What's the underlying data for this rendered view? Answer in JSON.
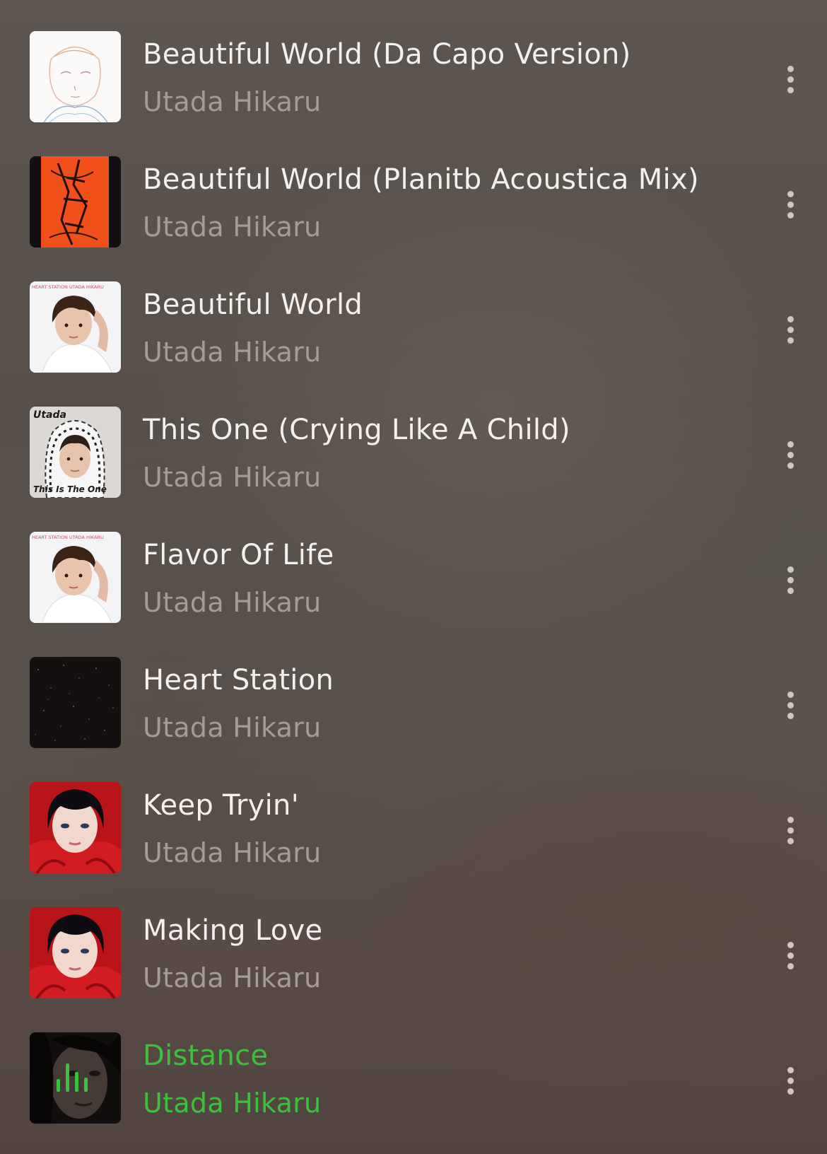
{
  "tracks": [
    {
      "title": "Beautiful World (Da Capo Version)",
      "artist": "Utada Hikaru",
      "cover": "sketch-portrait"
    },
    {
      "title": "Beautiful World (Planitb Acoustica Mix)",
      "artist": "Utada Hikaru",
      "cover": "orange-sketch"
    },
    {
      "title": "Beautiful World",
      "artist": "Utada Hikaru",
      "cover": "heart-station",
      "cover_text": "HEART STATION  UTADA HIKARU"
    },
    {
      "title": "This One (Crying Like A Child)",
      "artist": "Utada Hikaru",
      "cover": "this-is-the-one",
      "cover_text_top": "Utada",
      "cover_text_bottom": "This Is The One"
    },
    {
      "title": "Flavor Of Life",
      "artist": "Utada Hikaru",
      "cover": "heart-station",
      "cover_text": "HEART STATION  UTADA HIKARU"
    },
    {
      "title": "Heart Station",
      "artist": "Utada Hikaru",
      "cover": "starfield"
    },
    {
      "title": "Keep Tryin'",
      "artist": "Utada Hikaru",
      "cover": "red-scarf"
    },
    {
      "title": "Making Love",
      "artist": "Utada Hikaru",
      "cover": "red-scarf"
    },
    {
      "title": "Distance",
      "artist": "Utada Hikaru",
      "cover": "dark-face",
      "now_playing": true
    }
  ],
  "icons": {
    "more": "more-vertical-icon",
    "now_playing": "equalizer-icon"
  },
  "colors": {
    "playing_accent": "#3cc13f",
    "title": "#f3f0ee",
    "artist": "#a49c97"
  }
}
